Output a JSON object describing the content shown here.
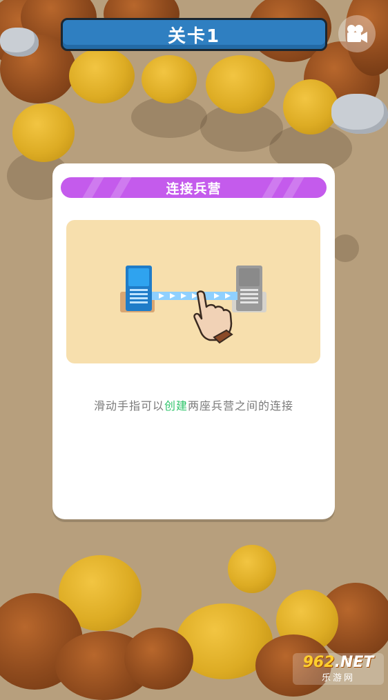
{
  "level": {
    "label": "关卡1"
  },
  "video_button": {
    "icon": "video-camera-icon"
  },
  "tutorial": {
    "title": "连接兵营",
    "description_before": "滑动手指可以",
    "description_highlight": "创建",
    "description_after": "两座兵营之间的连接",
    "highlight_color": "#2ec46a",
    "header_color": "#c45bec"
  },
  "watermark": {
    "brand_number": "962",
    "brand_suffix": ".NET",
    "site_name": "乐游网"
  }
}
